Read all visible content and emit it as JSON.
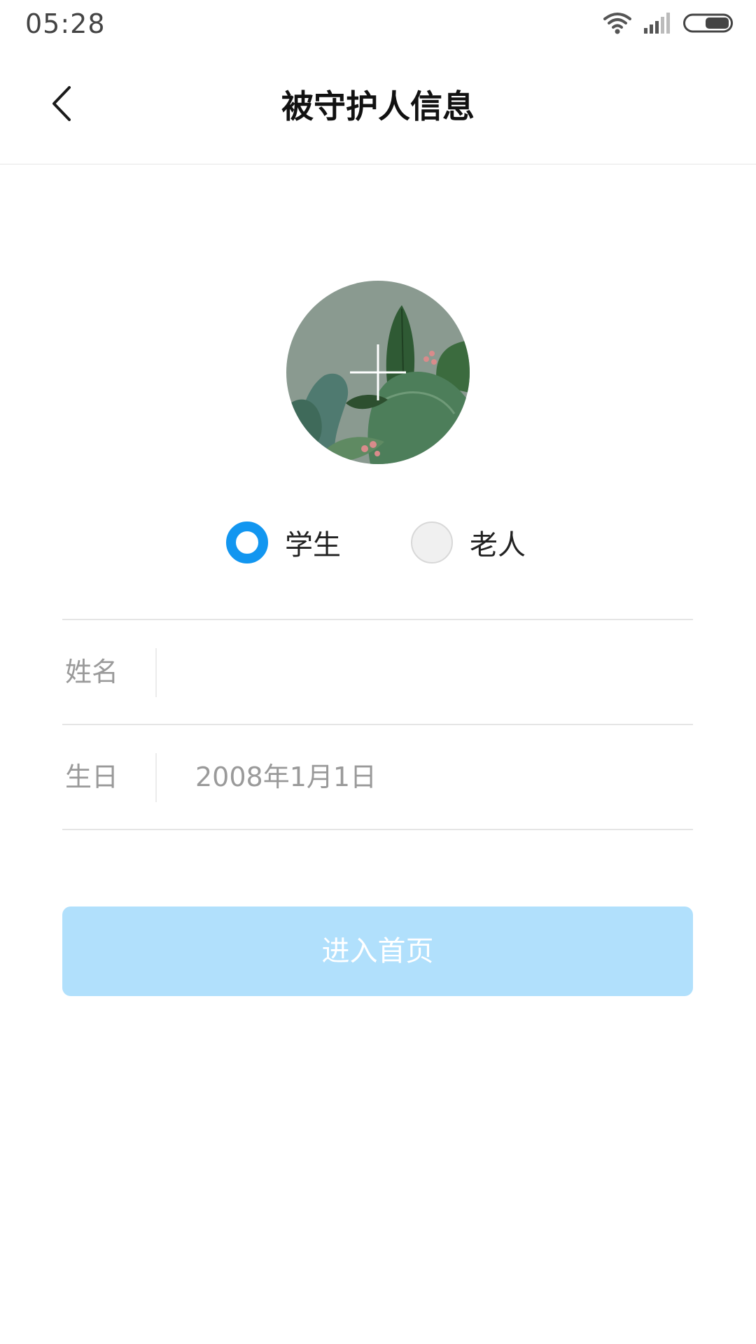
{
  "status_bar": {
    "time": "05:28",
    "icons": [
      "wifi-icon",
      "signal-icon",
      "battery-icon"
    ]
  },
  "header": {
    "back_icon": "chevron-left-icon",
    "title": "被守护人信息"
  },
  "avatar": {
    "icon": "plus-icon"
  },
  "role": {
    "options": [
      {
        "label": "学生",
        "selected": true
      },
      {
        "label": "老人",
        "selected": false
      }
    ]
  },
  "form": {
    "name": {
      "label": "姓名",
      "value": ""
    },
    "birthday": {
      "label": "生日",
      "value": "2008年1月1日"
    }
  },
  "submit": {
    "label": "进入首页"
  },
  "colors": {
    "accent": "#1296f0",
    "button_disabled": "#b1e0fc",
    "label_gray": "#9a9a9a",
    "divider": "#e5e5e5"
  }
}
